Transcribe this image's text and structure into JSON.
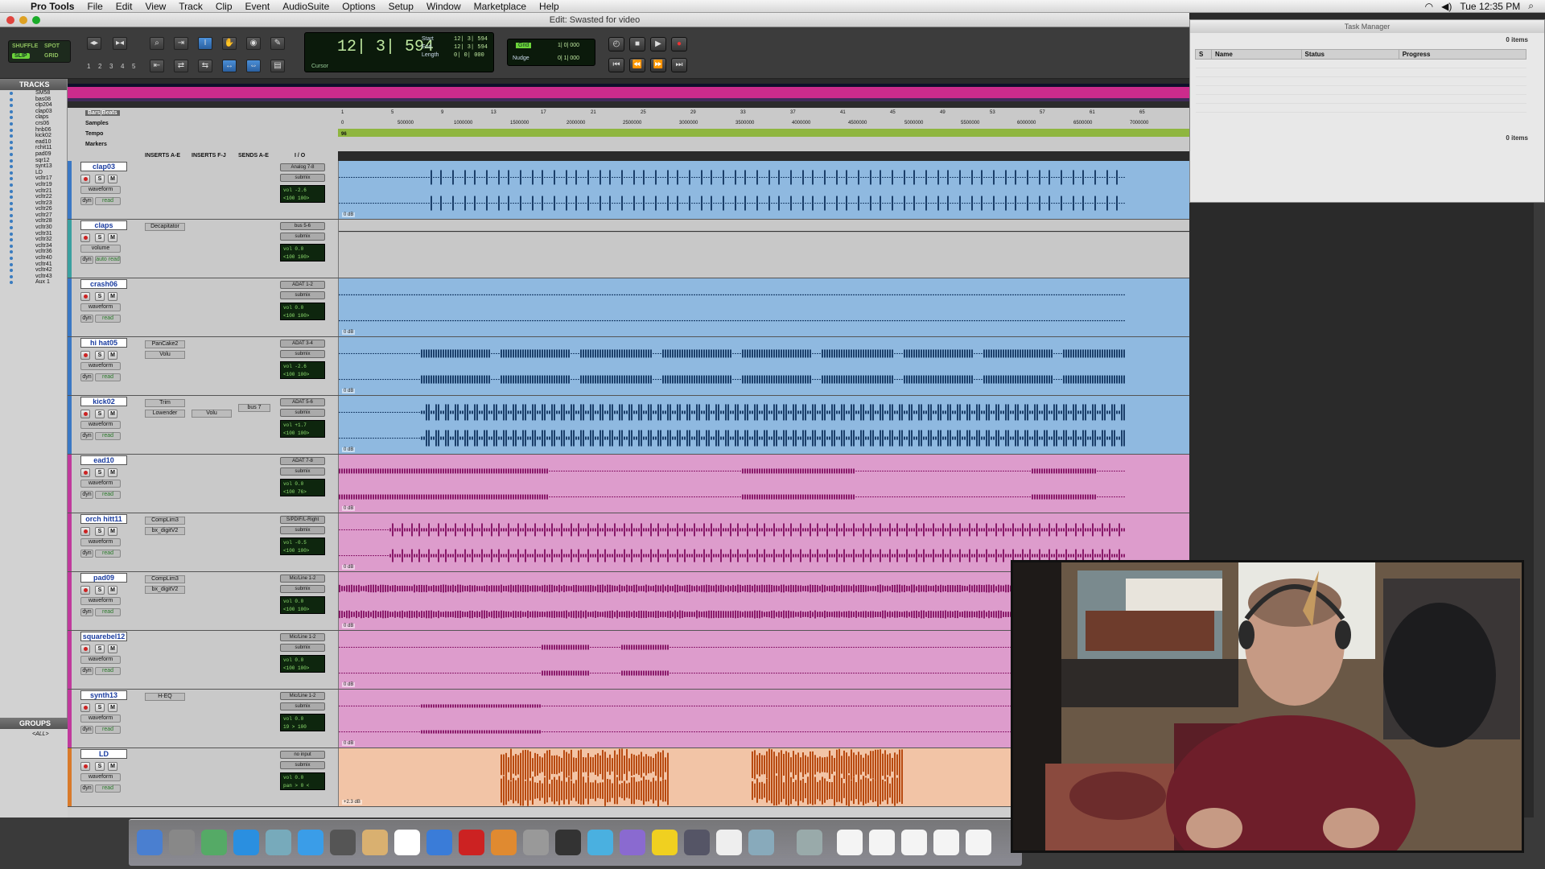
{
  "menubar": {
    "app": "Pro Tools",
    "items": [
      "File",
      "Edit",
      "View",
      "Track",
      "Clip",
      "Event",
      "AudioSuite",
      "Options",
      "Setup",
      "Window",
      "Marketplace",
      "Help"
    ],
    "clock": "Tue 12:35 PM"
  },
  "window": {
    "title": "Edit: Swasted for video"
  },
  "toolbar": {
    "modes": {
      "shuffle": "SHUFFLE",
      "spot": "SPOT",
      "slip": "SLIP",
      "grid": "GRID"
    },
    "zoom_presets": [
      "1",
      "2",
      "3",
      "4",
      "5"
    ],
    "main_counter": "12| 3| 594",
    "cursor_label": "Cursor",
    "start_label": "Start",
    "end_label": "End",
    "length_label": "Length",
    "start_value": "12| 3| 594",
    "end_value": "12| 3| 594",
    "length_value": "0| 0| 000",
    "grid_label": "Grid",
    "grid_value": "1| 0| 000",
    "nudge_label": "Nudge",
    "nudge_value": "0| 1| 000"
  },
  "rulers": {
    "bars_label": "Bars|Beats",
    "samples_label": "Samples",
    "tempo_label": "Tempo",
    "markers_label": "Markers",
    "tempo_value": "96",
    "bars": [
      "1",
      "5",
      "9",
      "13",
      "17",
      "21",
      "25",
      "29",
      "33",
      "37",
      "41",
      "45",
      "49",
      "53",
      "57",
      "61",
      "65"
    ],
    "samples": [
      "0",
      "500000",
      "1000000",
      "1500000",
      "2000000",
      "2500000",
      "3000000",
      "3500000",
      "4000000",
      "4500000",
      "5000000",
      "5500000",
      "6000000",
      "6500000",
      "7000000"
    ]
  },
  "mix_columns": {
    "inserts_ae": "INSERTS A-E",
    "inserts_fj": "INSERTS F-J",
    "sends_ae": "SENDS A-E",
    "io": "I / O"
  },
  "left_panel": {
    "tracks_title": "TRACKS",
    "track_list": [
      "SM58",
      "bas08",
      "clp204",
      "clap03",
      "claps",
      "crs06",
      "hnb06",
      "kick02",
      "ead10",
      "rchit11",
      "pad09",
      "sqr12",
      "synt13",
      "LD",
      "vcltr17",
      "vcltr19",
      "vcltr21",
      "vcltr22",
      "vcltr23",
      "vcltr26",
      "vcltr27",
      "vcltr28",
      "vcltr30",
      "vcltr31",
      "vcltr32",
      "vcltr34",
      "vcltr36",
      "vcltr40",
      "vcltr41",
      "vcltr42",
      "vcltr43",
      "Aux 1"
    ],
    "groups_title": "GROUPS",
    "groups_item": "<ALL>"
  },
  "tracks": [
    {
      "name": "clap03",
      "color": "#8fb9e0",
      "strip": "#3b78c4",
      "view": "waveform",
      "auto": "read",
      "input": "Analog 7-8",
      "output": "submix",
      "vol": "-2.6",
      "pan": "<100  100>",
      "inserts": [],
      "clip": "0 dB"
    },
    {
      "name": "claps",
      "color": "#c8c8c8",
      "strip": "#3aa0a0",
      "view": "volume",
      "auto": "auto read",
      "input": "bus 5-6",
      "output": "submix",
      "vol": "0.0",
      "pan": "<100  100>",
      "inserts": [
        "Decapitator"
      ],
      "clip": ""
    },
    {
      "name": "crash06",
      "color": "#8fb9e0",
      "strip": "#3b78c4",
      "view": "waveform",
      "auto": "read",
      "input": "ADAT 1-2",
      "output": "submix",
      "vol": "0.0",
      "pan": "<100  100>",
      "inserts": [],
      "clip": "0 dB"
    },
    {
      "name": "hi hat05",
      "color": "#8fb9e0",
      "strip": "#3b78c4",
      "view": "waveform",
      "auto": "read",
      "input": "ADAT 3-4",
      "output": "submix",
      "vol": "-2.6",
      "pan": "<100  100>",
      "inserts": [
        "PanCake2",
        "Volu"
      ],
      "clip": "0 dB"
    },
    {
      "name": "kick02",
      "color": "#8fb9e0",
      "strip": "#3b78c4",
      "view": "waveform",
      "auto": "read",
      "input": "ADAT 5-6",
      "output": "submix",
      "vol": "+1.7",
      "pan": "<100  100>",
      "inserts": [
        "Trim",
        "Lowender"
      ],
      "inserts_fj": [
        "Volu"
      ],
      "send": "bus 7",
      "clip": "0 dB"
    },
    {
      "name": "ead10",
      "color": "#dd9ccc",
      "strip": "#c03a9c",
      "view": "waveform",
      "auto": "read",
      "input": "ADAT 7-8",
      "output": "submix",
      "vol": "0.0",
      "pan": "<100  76>",
      "inserts": [],
      "clip": "0 dB"
    },
    {
      "name": "orch hitt11",
      "color": "#dd9ccc",
      "strip": "#c03a9c",
      "view": "waveform",
      "auto": "read",
      "input": "S/PDIF/L-Right",
      "output": "submix",
      "vol": "-0.5",
      "pan": "<100  100>",
      "inserts": [
        "CompLim3",
        "bx_digitV2"
      ],
      "clip": "0 dB"
    },
    {
      "name": "pad09",
      "color": "#dd9ccc",
      "strip": "#c03a9c",
      "view": "waveform",
      "auto": "read",
      "input": "Mic/Line 1-2",
      "output": "submix",
      "vol": "0.0",
      "pan": "<100  100>",
      "inserts": [
        "CompLim3",
        "bx_digitV2"
      ],
      "clip": "0 dB"
    },
    {
      "name": "squarebel12",
      "color": "#dd9ccc",
      "strip": "#c03a9c",
      "view": "waveform",
      "auto": "read",
      "input": "Mic/Line 1-2",
      "output": "submix",
      "vol": "0.0",
      "pan": "<100  100>",
      "inserts": [],
      "clip": "0 dB"
    },
    {
      "name": "synth13",
      "color": "#dd9ccc",
      "strip": "#c03a9c",
      "view": "waveform",
      "auto": "read",
      "input": "Mic/Line 1-2",
      "output": "submix",
      "vol": "0.0",
      "pan": "19 >  100",
      "inserts": [
        "H-EQ"
      ],
      "clip": "0 dB"
    },
    {
      "name": "LD",
      "color": "#f2c4a6",
      "strip": "#d97a2a",
      "view": "waveform",
      "auto": "read",
      "input": "no input",
      "output": "submix",
      "vol": "0.0",
      "pan": "pan  > 0 <",
      "inserts": [],
      "clip": "+2.3 dB"
    }
  ],
  "task_manager": {
    "title": "Task Manager",
    "items_top": "0 items",
    "items_bottom": "0 items",
    "columns": [
      "S",
      "Name",
      "Status",
      "Progress"
    ]
  }
}
